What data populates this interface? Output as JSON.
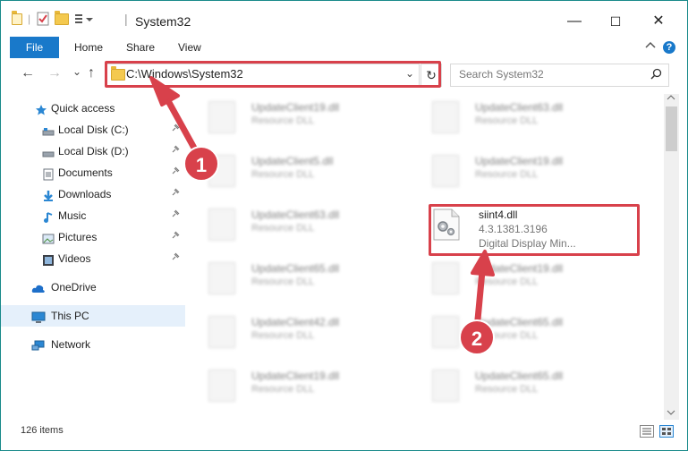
{
  "window": {
    "title": "System32",
    "minimize": "—",
    "maximize": "☐",
    "close": "✕"
  },
  "ribbon": {
    "file_tab": "File",
    "tabs": [
      "Home",
      "Share",
      "View"
    ],
    "help": "?"
  },
  "nav": {
    "back": "←",
    "forward": "→",
    "recent": "⌄",
    "up": "↑",
    "address": "C:\\Windows\\System32",
    "dropdown": "⌄",
    "refresh": "↻",
    "search_placeholder": "Search System32",
    "search_icon": "⚲"
  },
  "sidebar": {
    "items": [
      {
        "label": "Quick access",
        "icon": "star-icon",
        "pinned": false
      },
      {
        "label": "Local Disk (C:)",
        "icon": "drive-icon",
        "pinned": true
      },
      {
        "label": "Local Disk (D:)",
        "icon": "drive-icon",
        "pinned": true
      },
      {
        "label": "Documents",
        "icon": "documents-icon",
        "pinned": true
      },
      {
        "label": "Downloads",
        "icon": "downloads-icon",
        "pinned": true
      },
      {
        "label": "Music",
        "icon": "music-icon",
        "pinned": true
      },
      {
        "label": "Pictures",
        "icon": "pictures-icon",
        "pinned": true
      },
      {
        "label": "Videos",
        "icon": "videos-icon",
        "pinned": true
      },
      {
        "label": "OneDrive",
        "icon": "cloud-icon",
        "pinned": false
      },
      {
        "label": "This PC",
        "icon": "computer-icon",
        "pinned": false
      },
      {
        "label": "Network",
        "icon": "network-icon",
        "pinned": false
      }
    ],
    "pin_glyph": "📌"
  },
  "files": {
    "left": [
      {
        "name": "UpdateClient19.dll",
        "type": "Resource DLL"
      },
      {
        "name": "UpdateClient5.dll",
        "type": "Resource DLL"
      },
      {
        "name": "UpdateClient63.dll",
        "type": "Resource DLL"
      },
      {
        "name": "UpdateClient65.dll",
        "type": "Resource DLL"
      },
      {
        "name": "UpdateClient42.dll",
        "type": "Resource DLL"
      },
      {
        "name": "UpdateClient19.dll",
        "type": "Resource DLL"
      }
    ],
    "right": [
      {
        "name": "UpdateClient63.dll",
        "type": "Resource DLL"
      },
      {
        "name": "UpdateClient19.dll",
        "type": "Resource DLL"
      },
      {
        "name": "UpdateClient19.dll",
        "type": "Resource DLL"
      },
      {
        "name": "UpdateClient65.dll",
        "type": "Resource DLL"
      },
      {
        "name": "UpdateClient65.dll",
        "type": "Resource DLL"
      }
    ],
    "target": {
      "name": "siint4.dll",
      "version": "4.3.1381.3196",
      "description": "Digital Display Min..."
    }
  },
  "status": {
    "count": "126 items"
  },
  "annotations": {
    "step1": "1",
    "step2": "2",
    "color": "#d8414b"
  }
}
